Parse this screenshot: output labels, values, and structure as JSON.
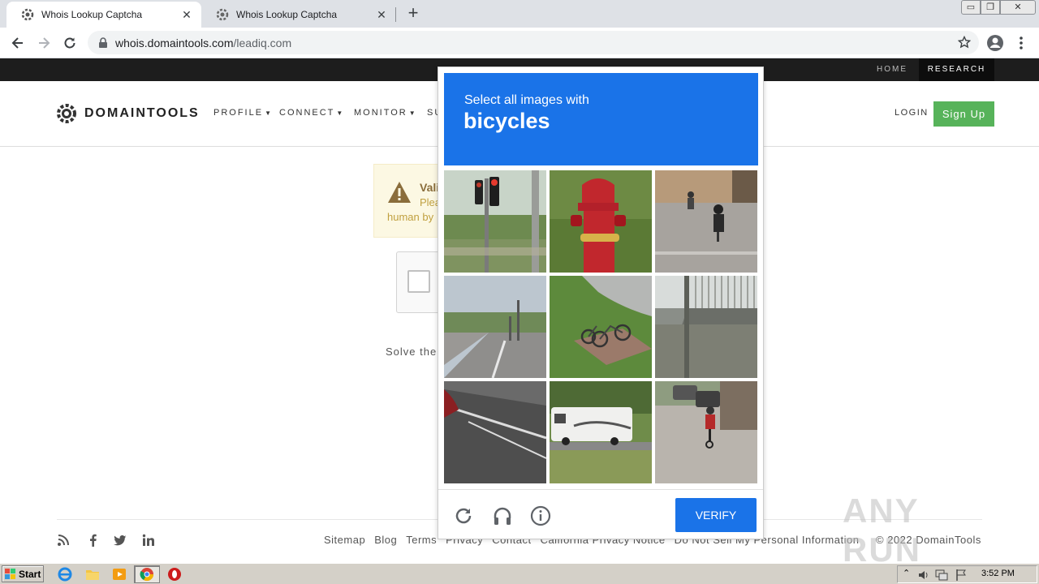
{
  "browser": {
    "tabs": [
      {
        "title": "Whois Lookup Captcha",
        "active": true
      },
      {
        "title": "Whois Lookup Captcha",
        "active": false
      }
    ],
    "close_glyph": "✕",
    "new_tab_glyph": "+",
    "url_host": "whois.domaintools.com",
    "url_path": "/leadiq.com",
    "window_controls": {
      "minimize": "▭",
      "maximize": "❐",
      "close": "✕"
    }
  },
  "site": {
    "topbar": {
      "home": "HOME",
      "research": "RESEARCH"
    },
    "logo_text": "DOMAINTOOLS",
    "nav": [
      {
        "label": "PROFILE",
        "caret": "▼"
      },
      {
        "label": "CONNECT",
        "caret": "▼"
      },
      {
        "label": "MONITOR",
        "caret": "▼"
      },
      {
        "label": "SU",
        "caret": ""
      }
    ],
    "login": "LOGIN",
    "signup": "Sign Up",
    "alert": {
      "line1": "Vali",
      "line2": "Plea",
      "line3": "human by"
    },
    "solve_text": "Solve the",
    "footer": {
      "links": [
        "Sitemap",
        "Blog",
        "Terms",
        "Privacy",
        "Contact",
        "California Privacy Notice",
        "Do Not Sell My Personal Information"
      ],
      "copyright": "© 2022 DomainTools"
    },
    "watermark": "ANY RUN"
  },
  "captcha": {
    "prompt": "Select all images with",
    "object": "bicycles",
    "verify": "VERIFY",
    "tiles": [
      "traffic-light",
      "fire-hydrant",
      "cyclist-street",
      "road-crossing",
      "parked-bicycles",
      "bridge-railing",
      "road-curb",
      "rv-camper",
      "cyclist-road"
    ]
  },
  "taskbar": {
    "start": "Start",
    "clock": "3:52 PM"
  },
  "colors": {
    "captcha_blue": "#1a73e8",
    "signup_green": "#57b35a",
    "topbar_dark": "#1d1d1d"
  }
}
